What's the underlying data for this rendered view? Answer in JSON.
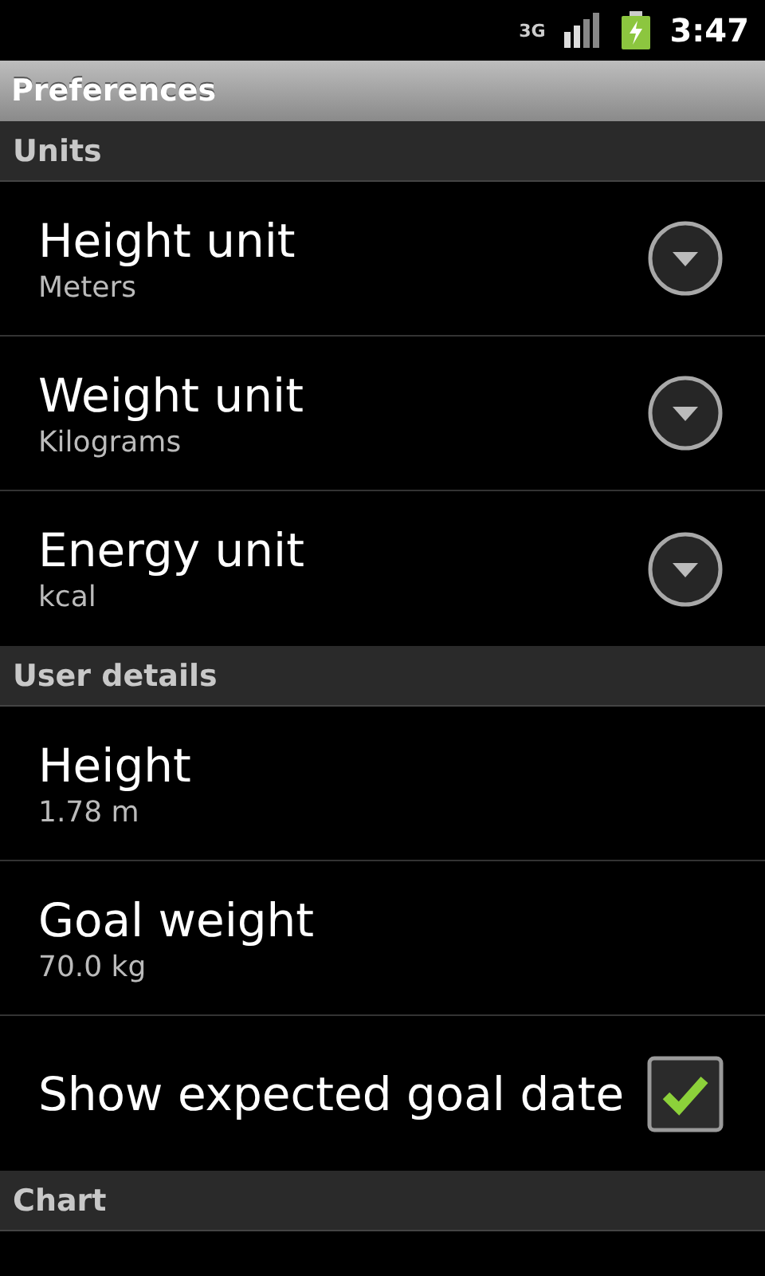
{
  "status_bar": {
    "network": "3G",
    "time": "3:47"
  },
  "window": {
    "title": "Preferences"
  },
  "sections": [
    {
      "title": "Units",
      "items": [
        {
          "kind": "list",
          "title": "Height unit",
          "summary": "Meters"
        },
        {
          "kind": "list",
          "title": "Weight unit",
          "summary": "Kilograms"
        },
        {
          "kind": "list",
          "title": "Energy unit",
          "summary": "kcal"
        }
      ]
    },
    {
      "title": "User details",
      "items": [
        {
          "kind": "text",
          "title": "Height",
          "summary": "1.78 m"
        },
        {
          "kind": "text",
          "title": "Goal weight",
          "summary": "70.0 kg"
        },
        {
          "kind": "checkbox",
          "title": "Show expected goal date",
          "checked": true
        }
      ]
    },
    {
      "title": "Chart"
    }
  ]
}
